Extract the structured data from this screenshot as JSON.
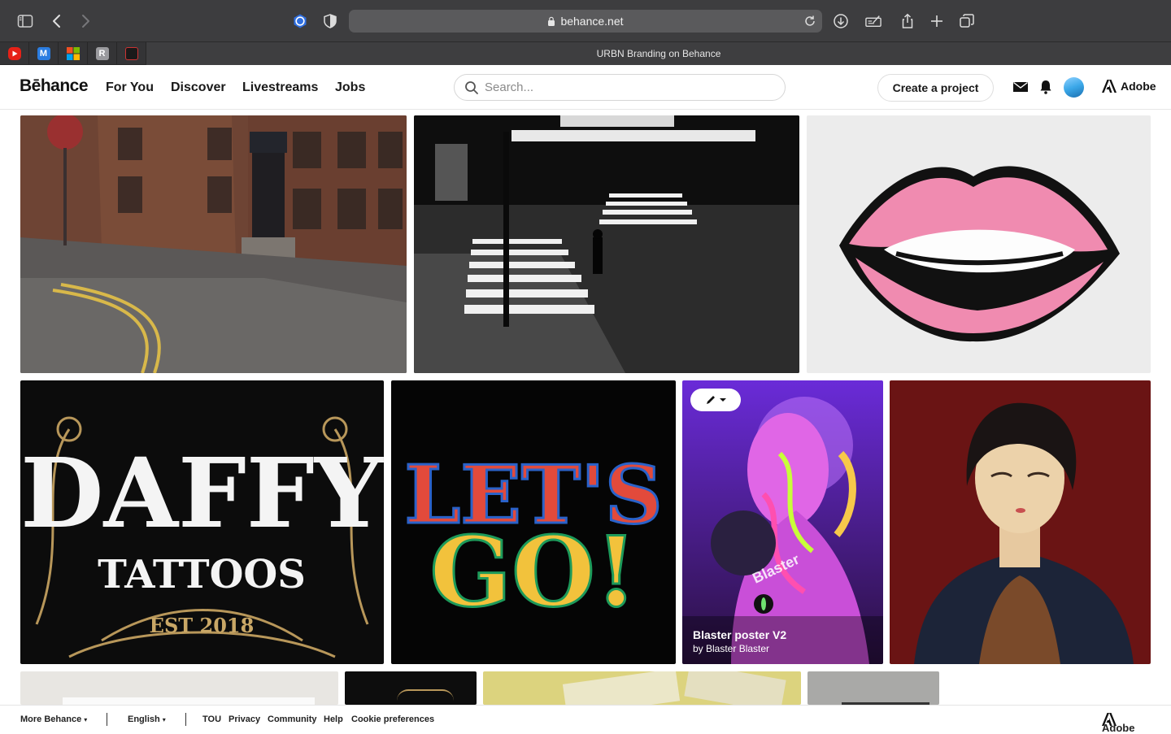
{
  "browser": {
    "url": "behance.net",
    "tab_title": "URBN Branding on Behance",
    "pinned_tabs": [
      "youtube-icon",
      "m-app-icon",
      "microsoft-icon",
      "r-app-icon",
      "mamv-icon"
    ]
  },
  "header": {
    "logo": "Bēhance",
    "nav": [
      "For You",
      "Discover",
      "Livestreams",
      "Jobs"
    ],
    "search_placeholder": "Search...",
    "create_button": "Create a project",
    "adobe_label": "Adobe"
  },
  "projects": [
    {
      "name": "red-brick-street-photo",
      "title": "",
      "by": ""
    },
    {
      "name": "night-crosswalk-photo",
      "title": "",
      "by": ""
    },
    {
      "name": "pop-art-lips-illustration",
      "title": "",
      "by": ""
    },
    {
      "name": "daffy-tattoos-lettering",
      "title": "",
      "by": ""
    },
    {
      "name": "lets-go-lettering",
      "title": "",
      "by": ""
    },
    {
      "name": "blaster-poster",
      "title": "Blaster poster V2",
      "by": "by Blaster Blaster"
    },
    {
      "name": "portrait-illustration",
      "title": "",
      "by": ""
    }
  ],
  "artwork_text": {
    "daffy": "DAFFY",
    "tattoos": "TATTOOS",
    "est": "EST 2018",
    "lets": "LET'S",
    "go": "GO!",
    "blaster_mark": "Blaster"
  },
  "footer": {
    "more": "More Behance",
    "language": "English",
    "links": [
      "TOU",
      "Privacy",
      "Community",
      "Help",
      "Cookie preferences"
    ],
    "adobe_label": "Adobe"
  },
  "colors": {
    "toolbar": "#3d3d3f",
    "tabbar": "#343436",
    "brick": "#6a4a3c",
    "lips_pink": "#f08bb0",
    "portrait_bg": "#6a1414"
  }
}
